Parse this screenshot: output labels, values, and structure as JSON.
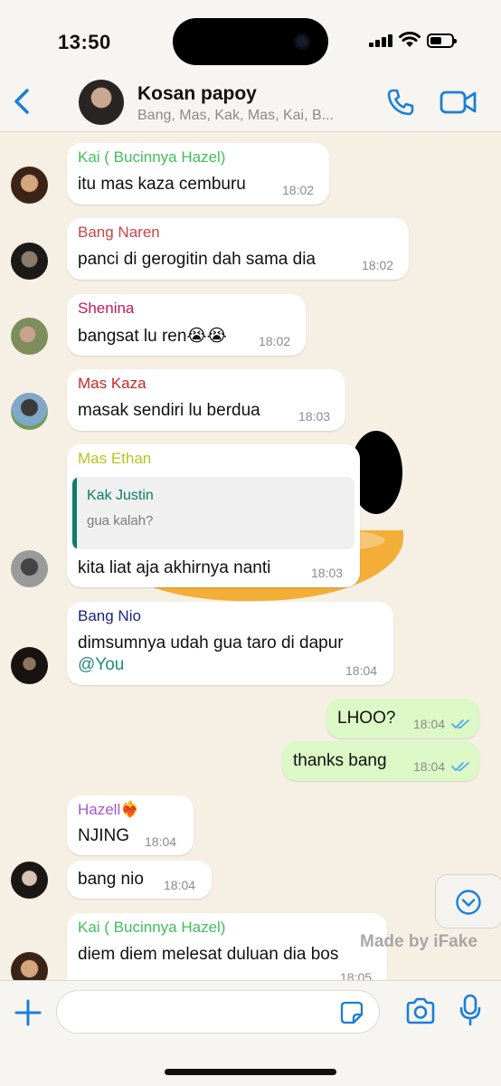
{
  "status_bar": {
    "time": "13:50"
  },
  "header": {
    "title": "Kosan papoy",
    "subtitle": "Bang, Mas, Kak, Mas, Kai, B..."
  },
  "colors": {
    "accent": "#1a7fd6",
    "outgoing_bubble": "#dcf8c6",
    "incoming_bubble": "#ffffff",
    "wallpaper": "#f6efe4"
  },
  "messages": [
    {
      "sender": "Kai ( Bucinnya Hazel)",
      "sender_color": "#3fc05c",
      "text": "itu mas kaza cemburu",
      "time": "18:02"
    },
    {
      "sender": "Bang Naren",
      "sender_color": "#c8464a",
      "text": "panci di gerogitin dah sama dia",
      "time": "18:02"
    },
    {
      "sender": "Shenina",
      "sender_color": "#c2185b",
      "text": "bangsat lu ren😭😭",
      "time": "18:02"
    },
    {
      "sender": "Mas Kaza",
      "sender_color": "#c62828",
      "text": "masak sendiri lu berdua",
      "time": "18:03"
    },
    {
      "sender": "Mas Ethan",
      "sender_color": "#b2c61f",
      "quote": {
        "name": "Kak Justin",
        "text": "gua kalah?"
      },
      "text": "kita liat aja akhirnya nanti",
      "time": "18:03"
    },
    {
      "sender": "Bang Nio",
      "sender_color": "#1a237e",
      "text": "dimsumnya udah gua taro di dapur",
      "mention": "@You",
      "time": "18:04"
    },
    {
      "outgoing": true,
      "text": "LHOO?",
      "time": "18:04"
    },
    {
      "outgoing": true,
      "text": "thanks bang",
      "time": "18:04"
    },
    {
      "sender": "Hazell❤️‍🔥",
      "sender_color": "#a855c8",
      "text": "NJING",
      "time": "18:04"
    },
    {
      "text": "bang nio",
      "time": "18:04"
    },
    {
      "sender": "Kai ( Bucinnya Hazel)",
      "sender_color": "#3fc05c",
      "text": "diem diem melesat duluan dia bos",
      "time": "18:05"
    }
  ],
  "watermark": "Made by iFake",
  "input": {
    "value": "",
    "placeholder": ""
  }
}
